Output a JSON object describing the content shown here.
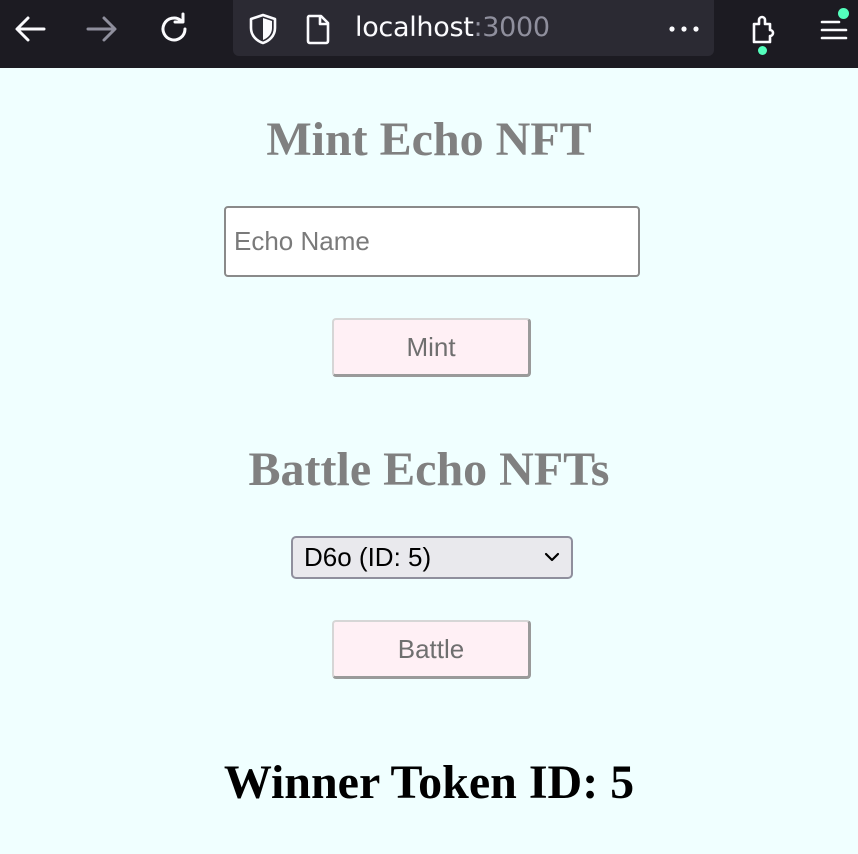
{
  "browser": {
    "url_host": "localhost",
    "url_port": ":3000",
    "icons": {
      "back": "arrow-left-icon",
      "forward": "arrow-right-icon",
      "reload": "reload-icon",
      "tracking": "shield-icon",
      "page": "page-icon",
      "more": "more-icon",
      "extensions": "extensions-icon",
      "menu": "hamburger-menu-icon"
    },
    "colors": {
      "toolbar": "#1c1b22",
      "urlbar": "#2b2a33",
      "notification_dot": "#54ffbd"
    }
  },
  "mint": {
    "title": "Mint Echo NFT",
    "name_placeholder": "Echo Name",
    "name_value": "",
    "button_label": "Mint"
  },
  "battle": {
    "title": "Battle Echo NFTs",
    "selected_option": "D6o (ID: 5)",
    "button_label": "Battle"
  },
  "result": {
    "winner_text": "Winner Token ID: 5"
  },
  "colors": {
    "page_background": "#f0ffff",
    "title_gray": "#808080",
    "button_pink": "#fff0f5"
  }
}
